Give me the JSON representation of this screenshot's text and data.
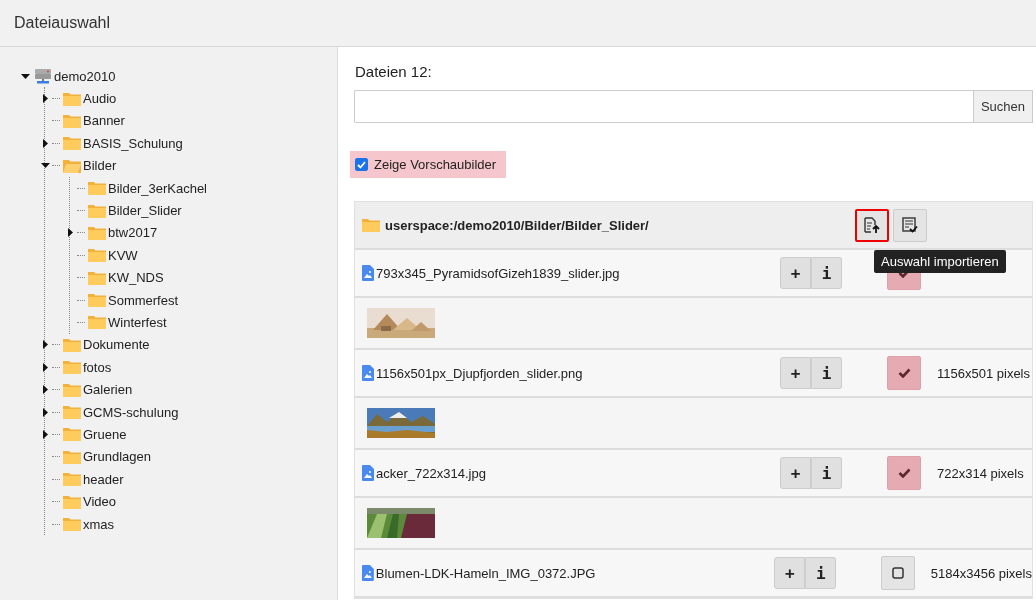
{
  "window": {
    "title": "Dateiauswahl"
  },
  "tree": {
    "root": {
      "label": "demo2010",
      "expanded": true,
      "children": [
        {
          "label": "Audio",
          "expandable": true,
          "expanded": false
        },
        {
          "label": "Banner",
          "expandable": false,
          "expanded": false
        },
        {
          "label": "BASIS_Schulung",
          "expandable": true,
          "expanded": false
        },
        {
          "label": "Bilder",
          "expandable": true,
          "expanded": true,
          "children": [
            {
              "label": "Bilder_3erKachel",
              "expandable": false,
              "expanded": false
            },
            {
              "label": "Bilder_Slider",
              "expandable": false,
              "expanded": false
            },
            {
              "label": "btw2017",
              "expandable": true,
              "expanded": false
            },
            {
              "label": "KVW",
              "expandable": false,
              "expanded": false
            },
            {
              "label": "KW_NDS",
              "expandable": false,
              "expanded": false
            },
            {
              "label": "Sommerfest",
              "expandable": false,
              "expanded": false
            },
            {
              "label": "Winterfest",
              "expandable": false,
              "expanded": false
            }
          ]
        },
        {
          "label": "Dokumente",
          "expandable": true,
          "expanded": false
        },
        {
          "label": "fotos",
          "expandable": true,
          "expanded": false
        },
        {
          "label": "Galerien",
          "expandable": true,
          "expanded": false
        },
        {
          "label": "GCMS-schulung",
          "expandable": true,
          "expanded": false
        },
        {
          "label": "Gruene",
          "expandable": true,
          "expanded": false
        },
        {
          "label": "Grundlagen",
          "expandable": false,
          "expanded": false
        },
        {
          "label": "header",
          "expandable": false,
          "expanded": false
        },
        {
          "label": "Video",
          "expandable": false,
          "expanded": false
        },
        {
          "label": "xmas",
          "expandable": false,
          "expanded": false
        }
      ]
    }
  },
  "files_heading": "Dateien 12:",
  "search": {
    "button": "Suchen"
  },
  "show_previews": {
    "label": "Zeige Vorschaubilder",
    "checked": true
  },
  "folder_path": "userspace:/demo2010/Bilder/Bilder_Slider/",
  "tooltip": "Auswahl importieren",
  "files": [
    {
      "name": "793x345_PyramidsofGizeh1839_slider.jpg",
      "add": "+",
      "info": "i",
      "selected": true
    },
    {
      "name": "1156x501px_Djupfjorden_slider.png",
      "add": "+",
      "info": "i",
      "selected": true,
      "size": "1156x501 pixels"
    },
    {
      "name": "acker_722x314.jpg",
      "add": "+",
      "info": "i",
      "selected": true,
      "size": "722x314 pixels"
    },
    {
      "name": "Blumen-LDK-Hameln_IMG_0372.JPG",
      "add": "+",
      "info": "i",
      "selected": false,
      "size": "5184x3456 pixels"
    }
  ]
}
